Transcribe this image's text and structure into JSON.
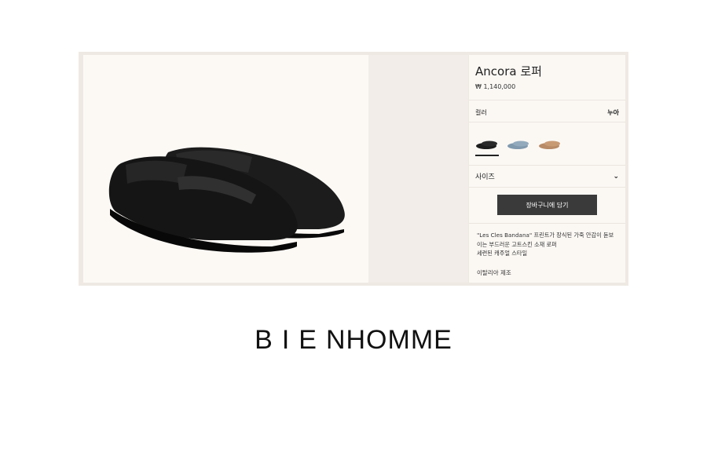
{
  "product": {
    "title": "Ancora 로퍼",
    "price": "₩ 1,140,000",
    "color_label": "컬러",
    "color_value": "누아",
    "swatches": [
      {
        "name": "black-loafer-swatch",
        "color": "#1d1d1d"
      },
      {
        "name": "blue-loafer-swatch",
        "color": "#8199ad"
      },
      {
        "name": "tan-loafer-swatch",
        "color": "#b88a66"
      }
    ],
    "size_label": "사이즈",
    "cart_button": "장바구니에 담기",
    "description_lines": [
      "\"Les Cles Bandana\" 프린트가 장식된 가죽 안감이 돋보",
      "이는 부드러운 고트스킨 소재 로퍼",
      "세련된 캐주얼 스타일"
    ],
    "origin": "이탈리아 제조"
  },
  "brand": {
    "logo_text_spaced": "BIE",
    "logo_text_rest": "NHOMME"
  }
}
